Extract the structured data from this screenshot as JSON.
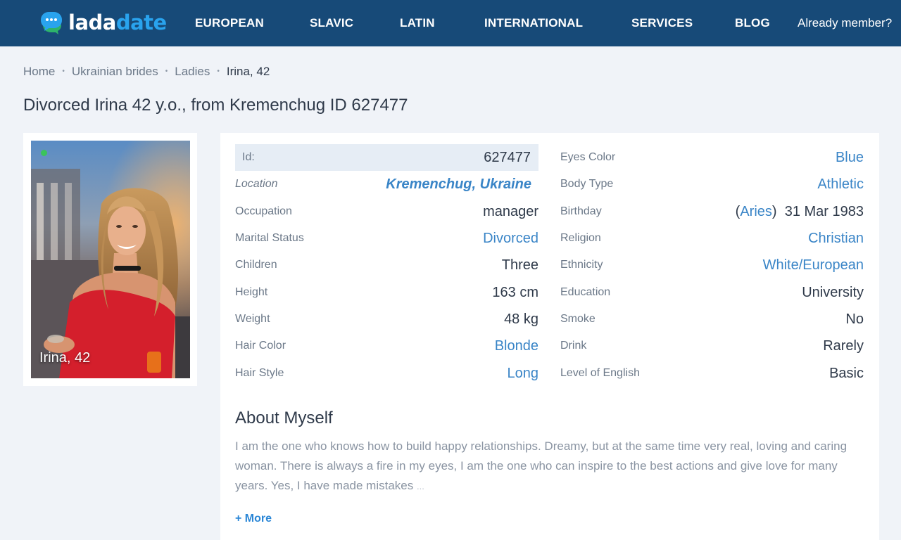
{
  "header": {
    "logo_part1": "lada",
    "logo_part2": "date",
    "nav": [
      "EUROPEAN",
      "SLAVIC",
      "LATIN",
      "INTERNATIONAL",
      "SERVICES",
      "BLOG"
    ],
    "member_link": "Already member?"
  },
  "breadcrumb": {
    "items": [
      "Home",
      "Ukrainian brides",
      "Ladies"
    ],
    "current": "Irina, 42",
    "separator": "•"
  },
  "title": "Divorced Irina 42 y.o., from Kremenchug ID 627477",
  "photo": {
    "caption": "Irina, 42",
    "online_status_color": "#3bc45a"
  },
  "profile": {
    "left": [
      {
        "label": "Id:",
        "value": "627477"
      },
      {
        "label": "Location",
        "value": "Kremenchug, Ukraine"
      },
      {
        "label": "Occupation",
        "value": "manager"
      },
      {
        "label": "Marital Status",
        "value": "Divorced"
      },
      {
        "label": "Children",
        "value": "Three"
      },
      {
        "label": "Height",
        "value": "163 cm"
      },
      {
        "label": "Weight",
        "value": "48 kg"
      },
      {
        "label": "Hair Color",
        "value": "Blonde"
      },
      {
        "label": "Hair Style",
        "value": "Long"
      }
    ],
    "right": [
      {
        "label": "Eyes Color",
        "value": "Blue"
      },
      {
        "label": "Body Type",
        "value": "Athletic"
      },
      {
        "label": "Birthday",
        "sign": "Aries",
        "date": "31 Mar 1983"
      },
      {
        "label": "Religion",
        "value": "Christian"
      },
      {
        "label": "Ethnicity",
        "value": "White/European"
      },
      {
        "label": "Education",
        "value": "University"
      },
      {
        "label": "Smoke",
        "value": "No"
      },
      {
        "label": "Drink",
        "value": "Rarely"
      },
      {
        "label": "Level of English",
        "value": "Basic"
      }
    ]
  },
  "about": {
    "title": "About Myself",
    "text": "I am the one who knows how to build happy relationships. Dreamy, but at the same time very real, loving and caring woman. There is always a fire in my eyes, I am the one who can inspire to the best actions and give love for many years. Yes, I have made mistakes",
    "ellipsis": "...",
    "more": "+ More"
  },
  "colors": {
    "header_bg": "#174a78",
    "accent": "#29a3ee",
    "link": "#3a85c7",
    "page_bg": "#f0f3f8"
  }
}
